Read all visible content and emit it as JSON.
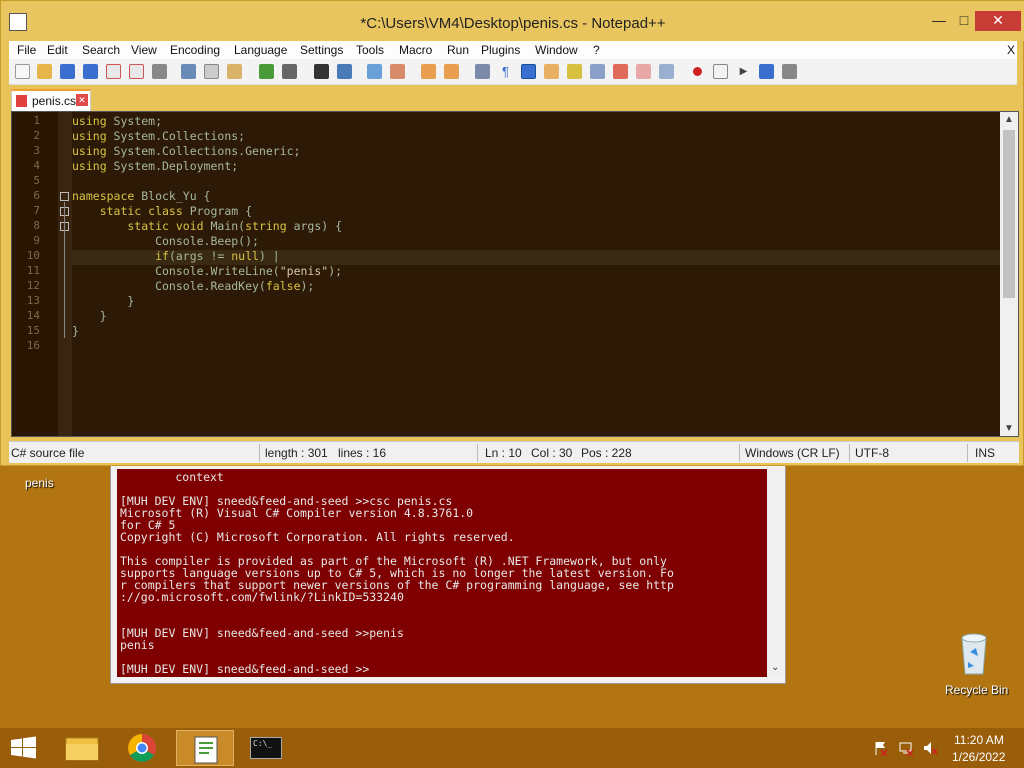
{
  "notepad": {
    "title": "*C:\\Users\\VM4\\Desktop\\penis.cs - Notepad++",
    "window_buttons": {
      "minimize": "—",
      "maximize": "□",
      "close": "✕"
    },
    "menu": [
      "File",
      "Edit",
      "Search",
      "View",
      "Encoding",
      "Language",
      "Settings",
      "Tools",
      "Macro",
      "Run",
      "Plugins",
      "Window",
      "?"
    ],
    "menu_close": "X",
    "tab": {
      "label": "penis.cs",
      "close": "✕"
    },
    "line_numbers": [
      "1",
      "2",
      "3",
      "4",
      "5",
      "6",
      "7",
      "8",
      "9",
      "10",
      "11",
      "12",
      "13",
      "14",
      "15",
      "16"
    ],
    "code": {
      "l1a": "using",
      "l1b": " System;",
      "l2a": "using",
      "l2b": " System.Collections;",
      "l3a": "using",
      "l3b": " System.Collections.Generic;",
      "l4a": "using",
      "l4b": " System.Deployment;",
      "l6a": "namespace",
      "l6b": " Block_Yu {",
      "l7a": "    static class",
      "l7b": " Program {",
      "l8a": "        static void",
      "l8b": " Main(",
      "l8c": "string",
      "l8d": " args) {",
      "l9": "            Console.Beep();",
      "l10a": "            if",
      "l10b": "(args != ",
      "l10c": "null",
      "l10d": ") |",
      "l11a": "            Console.WriteLine(",
      "l11b": "\"penis\"",
      "l11c": ");",
      "l12a": "            Console.ReadKey(",
      "l12b": "false",
      "l12c": ");",
      "l13": "        }",
      "l14": "    }",
      "l15": "}"
    },
    "status": {
      "file_type": "C# source file",
      "length": "length : 301",
      "lines": "lines : 16",
      "ln": "Ln : 10",
      "col": "Col : 30",
      "pos": "Pos : 228",
      "eol": "Windows (CR LF)",
      "encoding": "UTF-8",
      "mode": "INS"
    }
  },
  "console": {
    "text": "        context\n\n[MUH DEV ENV] sneed&feed-and-seed >>csc penis.cs\nMicrosoft (R) Visual C# Compiler version 4.8.3761.0\nfor C# 5\nCopyright (C) Microsoft Corporation. All rights reserved.\n\nThis compiler is provided as part of the Microsoft (R) .NET Framework, but only\nsupports language versions up to C# 5, which is no longer the latest version. Fo\nr compilers that support newer versions of the C# programming language, see http\n://go.microsoft.com/fwlink/?LinkID=533240\n\n\n[MUH DEV ENV] sneed&feed-and-seed >>penis\npenis\n\n[MUH DEV ENV] sneed&feed-and-seed >>"
  },
  "desktop": {
    "icon_penis": "penis",
    "icon_recycle": "Recycle Bin"
  },
  "taskbar": {
    "time": "11:20 AM",
    "date": "1/26/2022",
    "console_icon_text": "C:\\_"
  }
}
